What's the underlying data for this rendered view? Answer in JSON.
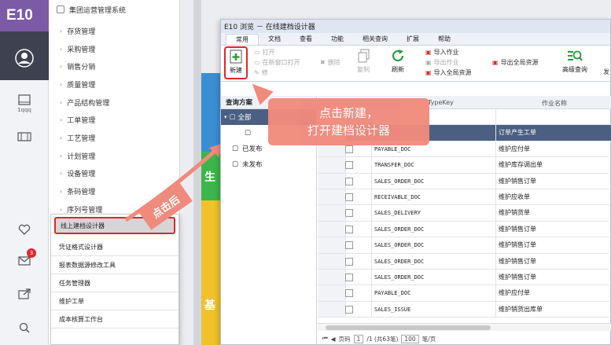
{
  "rail": {
    "logo": "E10",
    "items": [
      {
        "icon": "user-icon",
        "label": ""
      },
      {
        "icon": "window-icon",
        "label": "1qqq"
      },
      {
        "icon": "panel-icon",
        "label": ""
      },
      {
        "icon": "heart-icon",
        "label": ""
      },
      {
        "icon": "mail-icon",
        "label": "",
        "badge": "3"
      },
      {
        "icon": "share-icon",
        "label": ""
      },
      {
        "icon": "search-icon",
        "label": ""
      }
    ]
  },
  "menu": {
    "header": "集团运营管理系统",
    "items": [
      "存货管理",
      "采购管理",
      "销售分销",
      "质量管理",
      "产品结构管理",
      "工单管理",
      "工艺管理",
      "计划管理",
      "设备管理",
      "条码管理",
      "序列号管理"
    ]
  },
  "flyout": {
    "items": [
      "线上建档设计器",
      "凭证格式设计器",
      "报表数据源修改工具",
      "任务管理器",
      "维护工单",
      "成本核算工作台"
    ]
  },
  "annotation": {
    "tap_after": "点击后",
    "callout_line1": "点击新建，",
    "callout_line2": "打开建档设计器"
  },
  "bands": {
    "green_char": "生",
    "yellow_char": "基"
  },
  "window": {
    "title": "E10 浏览 － 在线建档设计器",
    "tabs": [
      "常用",
      "文档",
      "查看",
      "功能",
      "相关查询",
      "扩展",
      "帮助"
    ],
    "ribbon": {
      "new": "新建",
      "open": "打开",
      "open_new_window": "在新窗口打开",
      "modify": "修",
      "delete": "删除",
      "copy": "复制",
      "refresh": "刷新",
      "import_job": "导入作业",
      "export_job": "导出作业",
      "import_all": "导入全局资源",
      "export_all": "导出全局资源",
      "advanced_query": "高级查询",
      "publish_partial": "发"
    }
  },
  "tree": {
    "header": "查询方案",
    "root": "全部",
    "items": [
      "已发布",
      "未发布"
    ]
  },
  "grid": {
    "col_typekey": "TypeKey",
    "col_name": "作业名称",
    "rows": [
      {
        "code": "",
        "name": ""
      },
      {
        "code": "",
        "name": "订单产生工单"
      },
      {
        "code": "PAYABLE_DOC",
        "name": "维护应付单"
      },
      {
        "code": "TRANSFER_DOC",
        "name": "维护库存调出单"
      },
      {
        "code": "SALES_ORDER_DOC",
        "name": "维护销售订单"
      },
      {
        "code": "RECEIVABLE_DOC",
        "name": "维护应收单"
      },
      {
        "code": "SALES_DELIVERY",
        "name": "维护销货单"
      },
      {
        "code": "SALES_ORDER_DOC",
        "name": "维护销售订单"
      },
      {
        "code": "SALES_ORDER_DOC",
        "name": "维护销售订单"
      },
      {
        "code": "SALES_ORDER_DOC",
        "name": "维护销售订单"
      },
      {
        "code": "SALES_ORDER_DOC",
        "name": "维护销售订单"
      },
      {
        "code": "PAYABLE_DOC",
        "name": "维护应付单"
      },
      {
        "code": "SALES_ISSUE",
        "name": "维护销货出库单"
      }
    ],
    "pager": {
      "page_label": "页码",
      "page": "1",
      "total": "/1 (共63笔)",
      "page_size": "100",
      "per_page": "笔/页"
    }
  },
  "colors": {
    "accent_red": "#e0262a",
    "callout": "#f08a7c",
    "selected_row": "#4a5f82",
    "green_band": "#3cb54a",
    "yellow_band": "#efc12a",
    "blue_band": "#3a8fd4"
  }
}
